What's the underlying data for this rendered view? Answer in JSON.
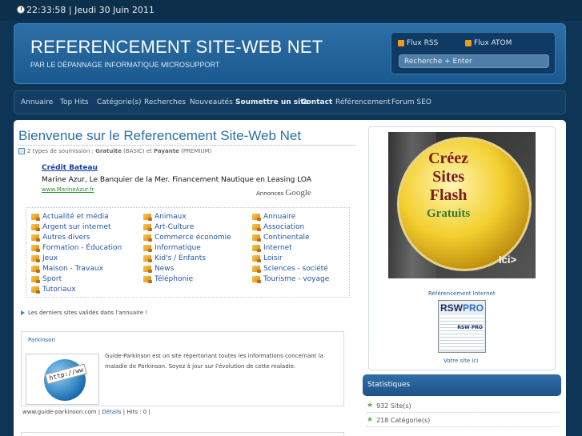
{
  "topbar": {
    "datetime": "22:33:58 | Jeudi 30 Juin 2011"
  },
  "header": {
    "title": "REFERENCEMENT SITE-WEB NET",
    "subtitle": "PAR LE DÉPANNAGE INFORMATIQUE MICROSUPPORT",
    "feeds": {
      "rss": "Flux RSS",
      "atom": "Flux ATOM"
    },
    "search_placeholder": "Recherche + Enter"
  },
  "nav": {
    "items": [
      {
        "label": "Annuaire"
      },
      {
        "label": "Top Hits"
      },
      {
        "label": "Catégorie(s)"
      },
      {
        "label": "Recherches"
      },
      {
        "label": "Nouveautés"
      },
      {
        "label": "Soumettre un site"
      },
      {
        "label": "Contact"
      },
      {
        "label": "Référencement"
      },
      {
        "label": "Forum SEO"
      }
    ]
  },
  "main": {
    "title": "Bienvenue sur le Referencement Site-Web Net",
    "meta": {
      "prefix": "2 types de soumission :",
      "free": "Gratuite",
      "free_note": "(BASIC) et",
      "paid": "Payante",
      "paid_note": "(PREMIUM)"
    },
    "ad": {
      "title": "Crédit Bateau",
      "text": "Marine Azur, Le Banquier de la Mer. Financement Nautique en Leasing LOA",
      "url": "www.MarineAzur.fr",
      "by_label": "Annonces",
      "by_brand": "Google"
    },
    "categories": [
      "Actualité et média",
      "Animaux",
      "Annuaire",
      "Argent sur internet",
      "Art-Culture",
      "Association",
      "Autres divers",
      "Commerce économie",
      "Continentale",
      "Formation - Éducation",
      "Informatique",
      "Internet",
      "Jeux",
      "Kid's / Enfants",
      "Loisir",
      "Maison - Travaux",
      "News",
      "Sciences - société",
      "Sport",
      "Téléphonie",
      "Tourisme - voyage",
      "Tutoriaux"
    ],
    "latest_label": "Les derniers sites validés dans l'annuaire !",
    "site": {
      "name": "Parkinson",
      "thumb_label": "http://ww",
      "description": "Guide-Parkinson est un site répertoriant toutes les informations concernant la maladie de Parkinson. Soyez à jour sur l'évolution de cette maladie.",
      "url": "www.guide-parkinson.com",
      "sep1": "|",
      "details": "Détails",
      "hits": "| Hits : 0 |"
    }
  },
  "sidebar": {
    "badge": {
      "line1": "Créez",
      "line2": "Sites",
      "line3": "Flash",
      "line4": "Gratuits",
      "cta": "Ici>"
    },
    "ref_label": "Référencement Internet",
    "rsw": {
      "brand1": "RSW",
      "brand2": "PRO",
      "mini": "RSW PRO"
    },
    "site_link": "Votre site ici",
    "stats": {
      "title": "Statistiques",
      "sites": "932 Site(s)",
      "categories": "218 Catégorie(s)"
    }
  }
}
